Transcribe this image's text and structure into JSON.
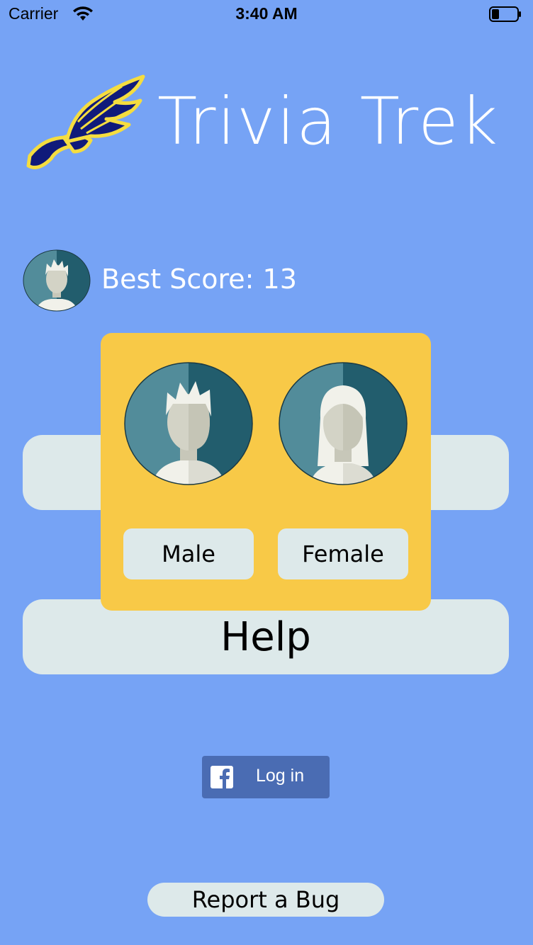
{
  "status_bar": {
    "carrier": "Carrier",
    "time": "3:40 AM",
    "wifi_icon": "wifi-icon",
    "battery_icon": "battery-icon"
  },
  "header": {
    "title": "Trivia Trek",
    "logo_icon": "winged-shoe-icon"
  },
  "best_score": {
    "label": "Best Score: 13",
    "avatar_icon": "male-avatar-icon"
  },
  "main_buttons": {
    "hidden_button_label": "",
    "help_label": "Help"
  },
  "gender_picker": {
    "male_label": "Male",
    "female_label": "Female",
    "male_icon": "male-avatar-icon",
    "female_icon": "female-avatar-icon"
  },
  "facebook": {
    "login_label": "Log in",
    "icon": "facebook-icon"
  },
  "report": {
    "label": "Report a Bug"
  },
  "colors": {
    "background": "#76a3f5",
    "button_bg": "#dde9ea",
    "popup_bg": "#f8c947",
    "facebook_blue": "#4a6cb3",
    "avatar_light": "#528c9a",
    "avatar_dark": "#225d6d"
  }
}
